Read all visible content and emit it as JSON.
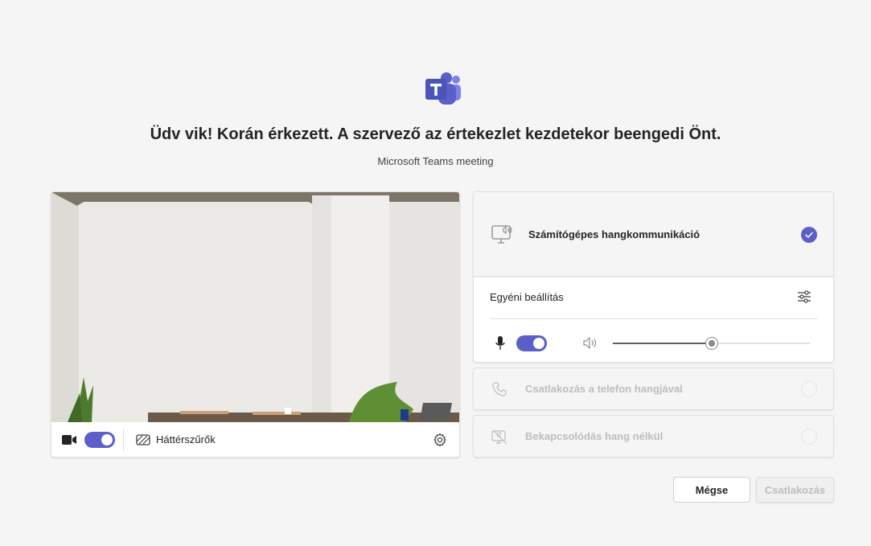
{
  "app": {
    "logo_icon": "teams-logo-icon",
    "brand_color": "#5b5fc7"
  },
  "header": {
    "title": "Üdv vik! Korán érkezett. A szervező az értekezlet kezdetekor beengedi Önt.",
    "subtitle": "Microsoft Teams meeting"
  },
  "video": {
    "camera_icon": "camera-icon",
    "camera_on": true,
    "background_filters_label": "Háttérszűrők",
    "background_filters_icon": "background-filters-icon",
    "settings_icon": "gear-icon"
  },
  "audio": {
    "computer_audio_label": "Számítógépes hangkommunikáció",
    "computer_audio_selected": true,
    "custom_setup_label": "Egyéni beállítás",
    "mic_on": true,
    "speaker_volume": 0.5,
    "phone_audio_label": "Csatlakozás a telefon hangjával",
    "no_audio_label": "Bekapcsolódás hang nélkül"
  },
  "actions": {
    "cancel_label": "Mégse",
    "join_label": "Csatlakozás"
  }
}
